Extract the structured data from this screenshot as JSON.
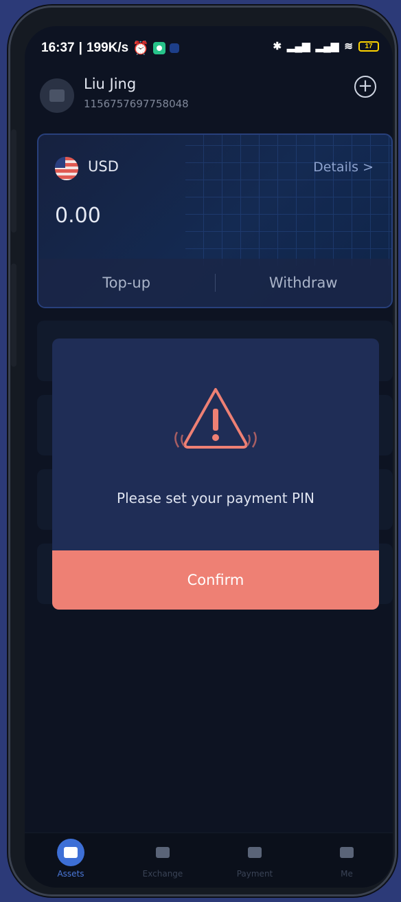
{
  "status_bar": {
    "time": "16:37",
    "net_speed": "199K/s",
    "battery": "17"
  },
  "profile": {
    "name": "Liu Jing",
    "uid": "1156757697758048"
  },
  "account": {
    "currency": "USD",
    "details_label": "Details >",
    "balance": "0.00",
    "topup_label": "Top-up",
    "withdraw_label": "Withdraw"
  },
  "dialog": {
    "message": "Please set your payment PIN",
    "confirm_label": "Confirm"
  },
  "bottom_nav": {
    "items": [
      {
        "label": "Assets",
        "icon": "wallet-icon",
        "active": true
      },
      {
        "label": "Exchange",
        "icon": "exchange-icon",
        "active": false
      },
      {
        "label": "Payment",
        "icon": "card-icon",
        "active": false
      },
      {
        "label": "Me",
        "icon": "user-icon",
        "active": false
      }
    ]
  },
  "colors": {
    "accent": "#ee8074",
    "nav_active": "#3d6fd6",
    "warning": "#ee8074"
  }
}
